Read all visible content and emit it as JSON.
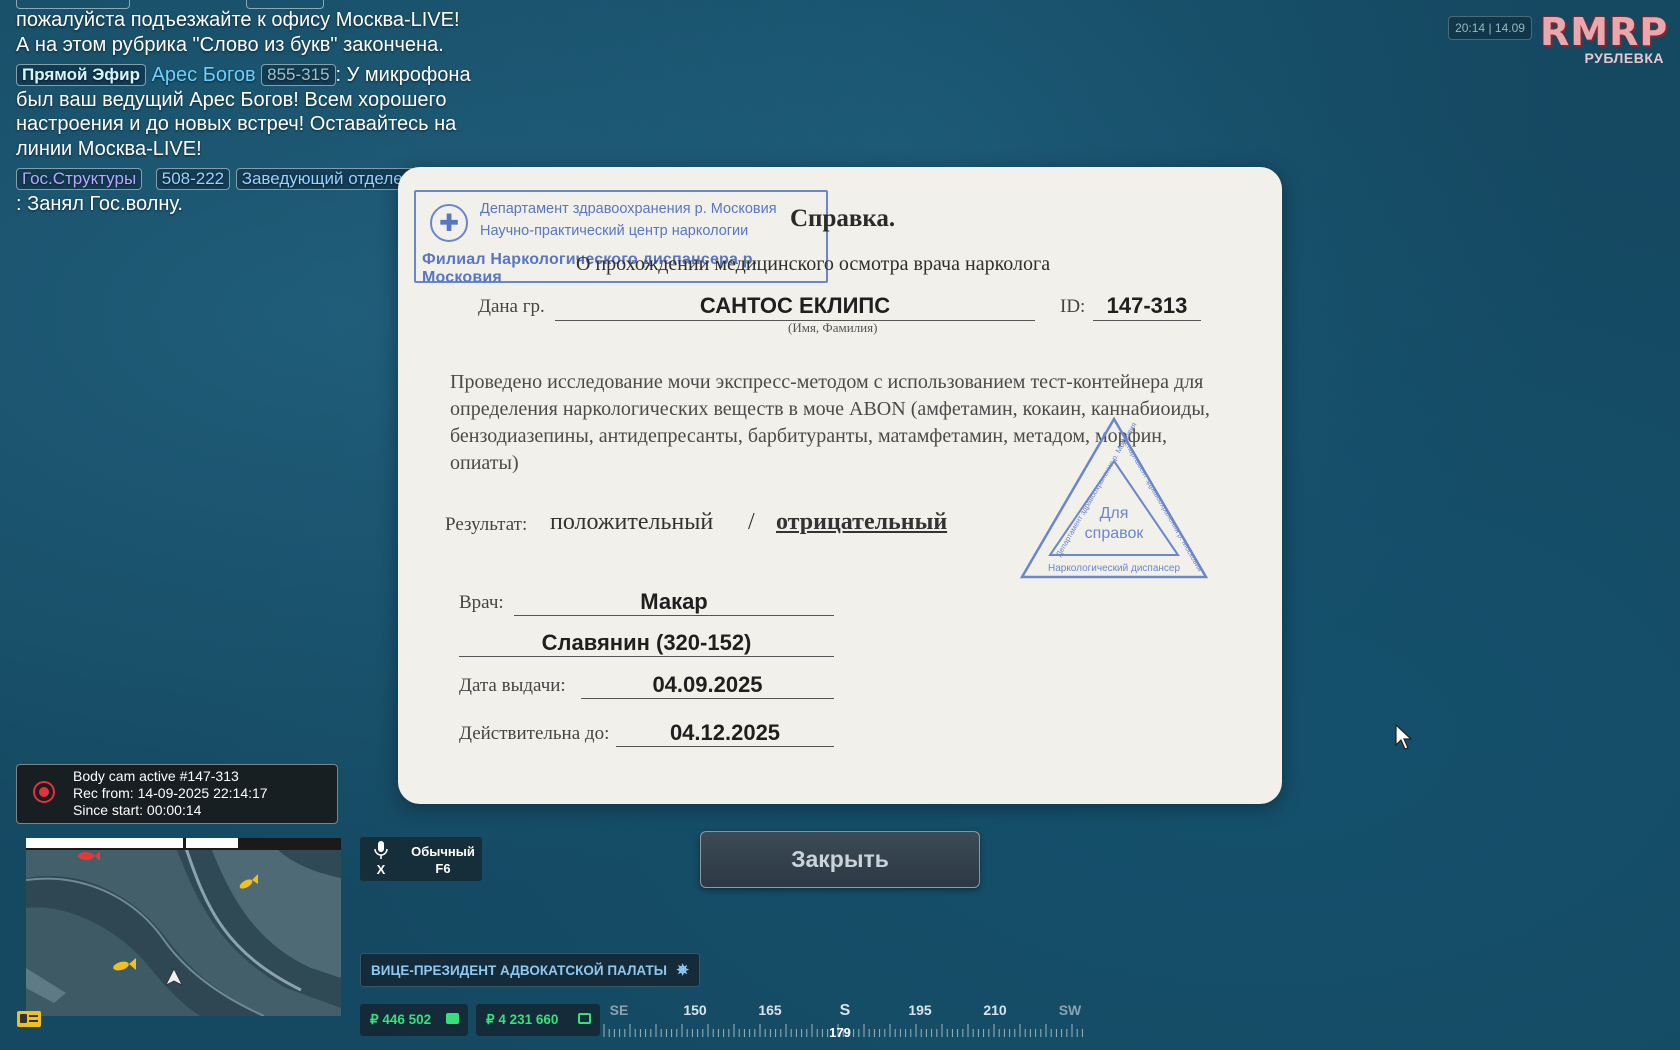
{
  "chat": {
    "line1": "пожалуйста подъезжайте к офису Москва-LIVE!",
    "line2": "А на этом рубрика \"Слово из букв\" закончена.",
    "msg2": {
      "tag": "Прямой Эфир",
      "name": "Арес Богов",
      "number": "855-315",
      "text": ": У микрофона был ваш ведущий Арес Богов! Всем хорошего настроения и до новых встреч! Оставайтесь на линии Москва-LIVE!"
    },
    "msg3": {
      "tag": "Гос.Структуры",
      "number": "508-222",
      "position": "Заведующий отделения",
      "text": ": Занял Гос.волну."
    }
  },
  "hud": {
    "clock": "20:14 | 14.09",
    "logo_main": "RMRP",
    "logo_sub": "РУБЛЕВКА"
  },
  "document": {
    "stamp_line1": "Департамент здравоохранения р. Московия",
    "stamp_line2": "Научно-практический центр наркологии",
    "stamp_line3": "Филиал Наркологического диспансера р. Московия",
    "title": "Справка.",
    "subtitle": "О прохождении медицинского осмотра врача нарколога",
    "issued_to_label": "Дана гр.",
    "name_value": "САНТОС ЕКЛИПС",
    "name_hint": "(Имя, Фамилия)",
    "id_label": "ID:",
    "id_value": "147-313",
    "body": "Проведено исследование мочи экспресс-методом с использованием тест-контейнера для определения наркологических веществ в моче ABON (амфетамин, кокаин, каннабиоиды, бензодиазепины, антидепресанты, барбитуранты, матамфетамин, метадом, морфин, опиаты)",
    "result_label": "Результат:",
    "result_positive": "положительный",
    "result_sep": "/",
    "result_negative": "отрицательный",
    "doctor_label": "Врач:",
    "doctor_line1": "Макар",
    "doctor_line2": "Славянин (320-152)",
    "issue_date_label": "Дата выдачи:",
    "issue_date": "04.09.2025",
    "valid_label": "Действительна до:",
    "valid_date": "04.12.2025",
    "tri_stamp_center1": "Для",
    "tri_stamp_center2": "справок",
    "tri_stamp_bottom": "Наркологический диспансер",
    "tri_stamp_left": "Департамент здравоохранения р. Московия",
    "tri_stamp_right": "Департамент здравоохранения р. Московия"
  },
  "close_button": "Закрыть",
  "bodycam": {
    "line1": "Body cam active #147-313",
    "line2": "Rec from: 14-09-2025 22:14:17",
    "line3": "Since start: 00:00:14"
  },
  "voice": {
    "key": "X",
    "mode": "Обычный",
    "hotkey": "F6"
  },
  "rank": "ВИЦЕ-ПРЕЗИДЕНТ АДВОКАТСКОЙ ПАЛАТЫ",
  "money": {
    "cash": "₽ 446 502",
    "bank": "₽ 4 231 660"
  },
  "compass": {
    "labels": [
      "SE",
      "150",
      "165",
      "S",
      "195",
      "210",
      "SW"
    ],
    "heading": "179"
  },
  "colors": {
    "background": "#154861",
    "document": "#f2f0ea",
    "stamp": "#6a86cc",
    "cash_green": "#37e07a",
    "rank_blue": "#8ec8f0",
    "rec_red": "#e6303a"
  }
}
